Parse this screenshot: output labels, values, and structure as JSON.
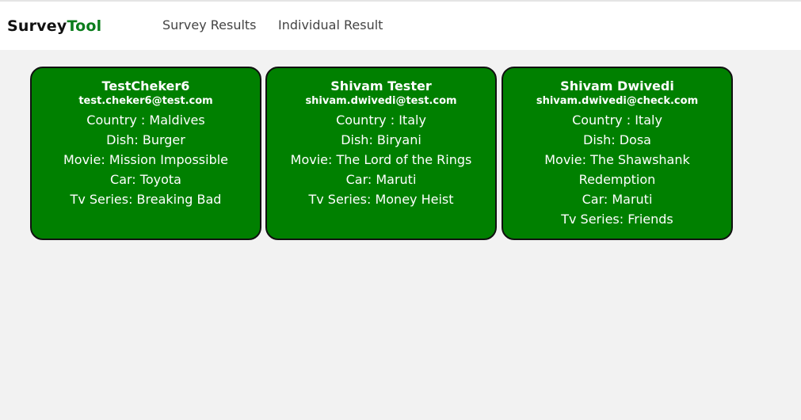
{
  "brand": {
    "part1": "Survey",
    "part2": "Tool",
    "colors": {
      "part1": "#111111",
      "part2": "#0b7d1c"
    }
  },
  "nav": {
    "items": [
      {
        "label": "Survey Results"
      },
      {
        "label": "Individual Result"
      }
    ]
  },
  "theme": {
    "card_background": "#008000",
    "page_background": "#f2f2f2"
  },
  "cards": [
    {
      "name": "TestCheker6",
      "email": "test.cheker6@test.com",
      "country": "Country : Maldives",
      "dish": "Dish: Burger",
      "movie": "Movie: Mission Impossible",
      "car": "Car: Toyota",
      "tv": "Tv Series: Breaking Bad"
    },
    {
      "name": "Shivam Tester",
      "email": "shivam.dwivedi@test.com",
      "country": "Country : Italy",
      "dish": "Dish: Biryani",
      "movie": "Movie: The Lord of the Rings",
      "car": "Car: Maruti",
      "tv": "Tv Series: Money Heist"
    },
    {
      "name": "Shivam Dwivedi",
      "email": "shivam.dwivedi@check.com",
      "country": "Country : Italy",
      "dish": "Dish: Dosa",
      "movie": "Movie: The Shawshank Redemption",
      "car": "Car: Maruti",
      "tv": "Tv Series: Friends"
    }
  ]
}
